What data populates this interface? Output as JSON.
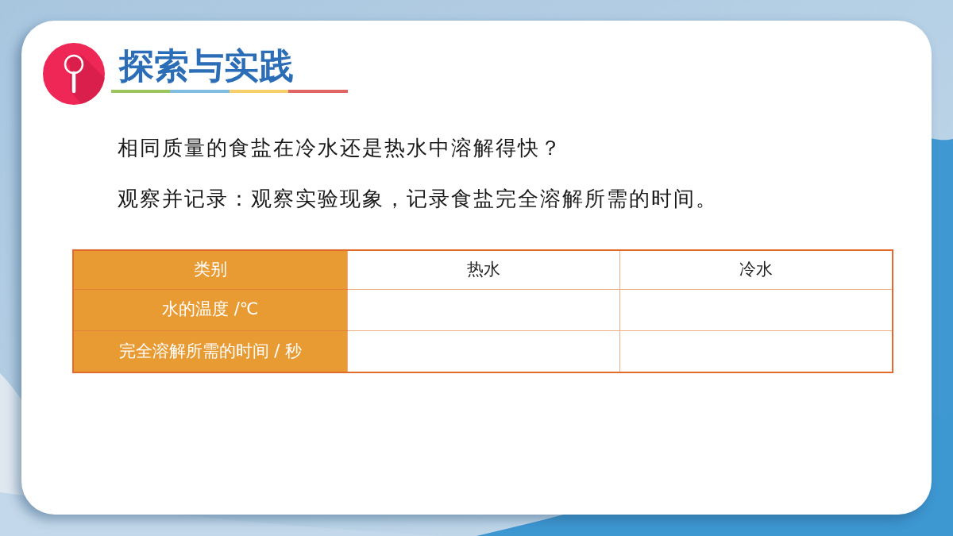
{
  "title": "探索与实践",
  "question": "相同质量的食盐在冷水还是热水中溶解得快？",
  "instruction": "观察并记录：观察实验现象，记录食盐完全溶解所需的时间。",
  "table": {
    "columns": [
      "类别",
      "热水",
      "冷水"
    ],
    "rows": [
      {
        "label": "水的温度 /℃"
      },
      {
        "label": "完全溶解所需的时间 / 秒"
      }
    ]
  }
}
